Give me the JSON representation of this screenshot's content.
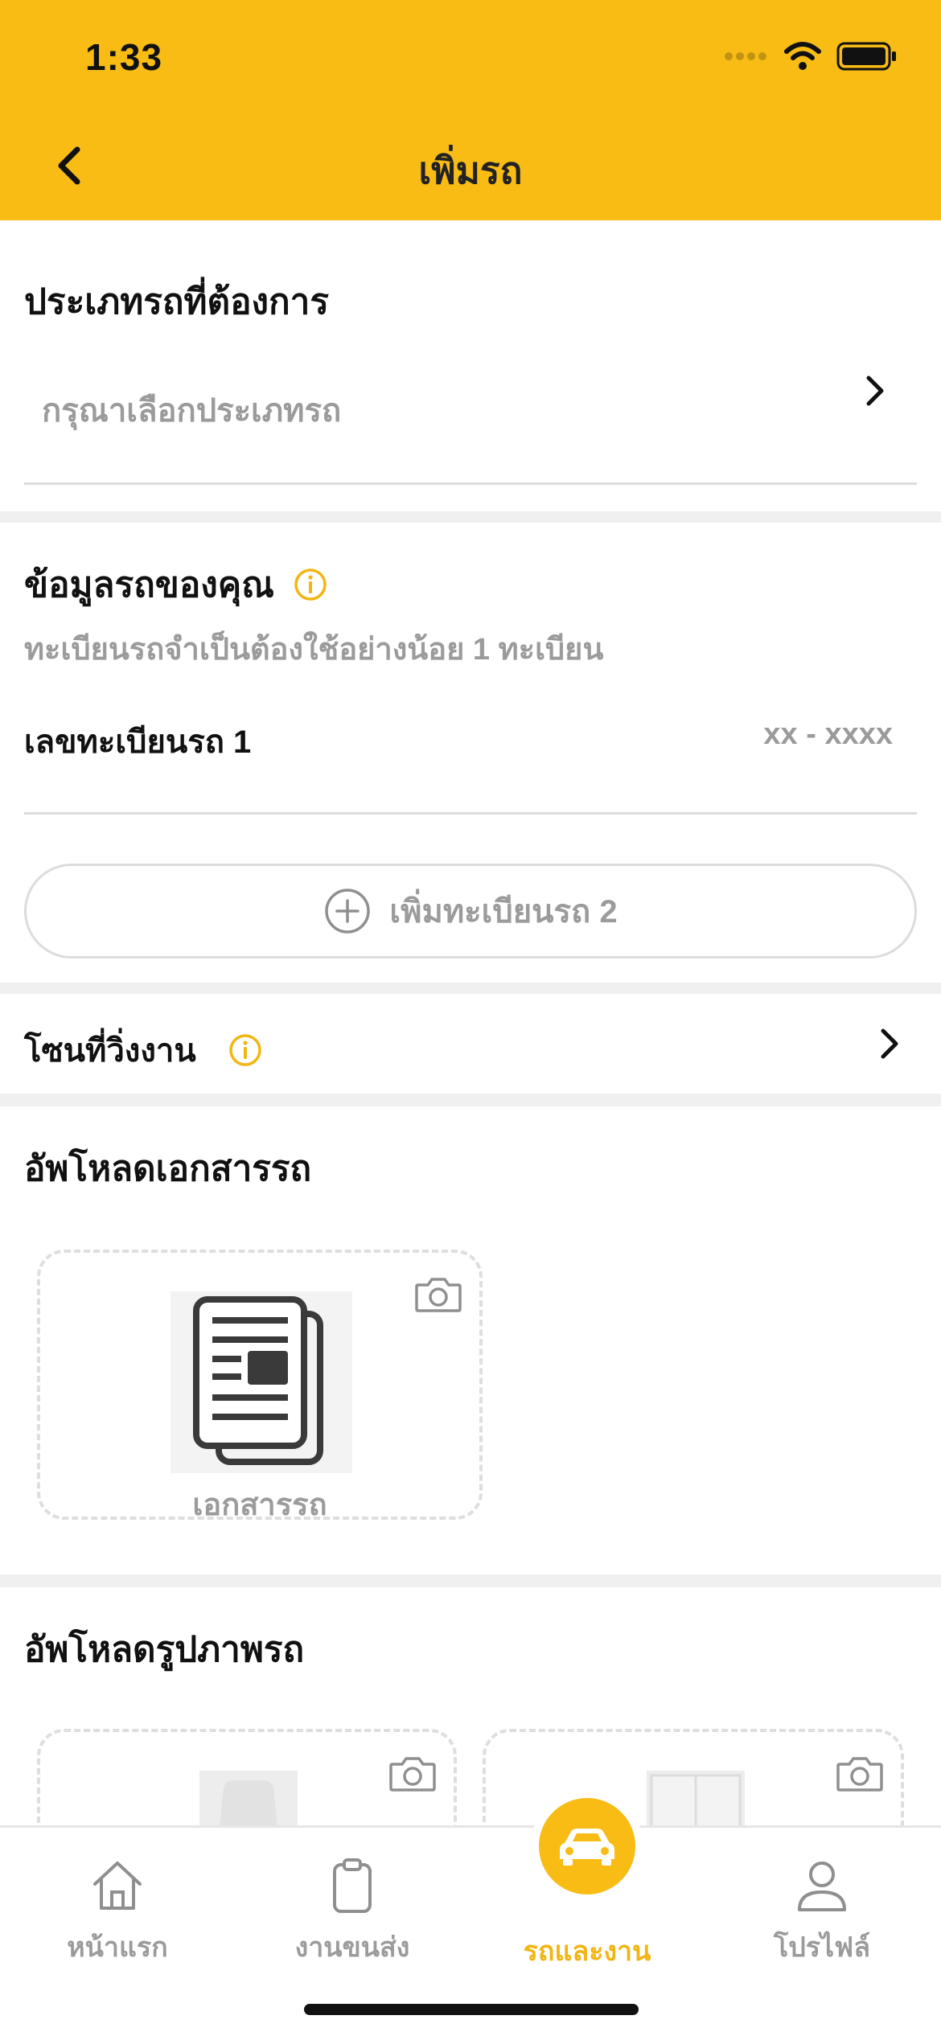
{
  "status_bar": {
    "time": "1:33"
  },
  "header": {
    "title": "เพิ่มรถ"
  },
  "vehicle_type": {
    "title": "ประเภทรถที่ต้องการ",
    "placeholder": "กรุณาเลือกประเภทรถ"
  },
  "vehicle_info": {
    "title": "ข้อมูลรถของคุณ",
    "subtitle": "ทะเบียนรถจำเป็นต้องใช้อย่างน้อย 1 ทะเบียน",
    "plate_label": "เลขทะเบียนรถ 1",
    "plate_placeholder": "xx - xxxx",
    "add_plate_label": "เพิ่มทะเบียนรถ 2"
  },
  "zone": {
    "label": "โซนที่วิ่งงาน"
  },
  "documents": {
    "title": "อัพโหลดเอกสารรถ",
    "card_label": "เอกสารรถ"
  },
  "photos": {
    "title": "อัพโหลดรูปภาพรถ"
  },
  "bottom_nav": {
    "items": [
      {
        "label": "หน้าแรก"
      },
      {
        "label": "งานขนส่ง"
      },
      {
        "label": "รถและงาน"
      },
      {
        "label": "โปรไฟล์"
      }
    ],
    "active_index": 2
  },
  "colors": {
    "accent": "#F8BC15",
    "muted": "#9b9b9b",
    "active_nav": "#F3B512"
  }
}
